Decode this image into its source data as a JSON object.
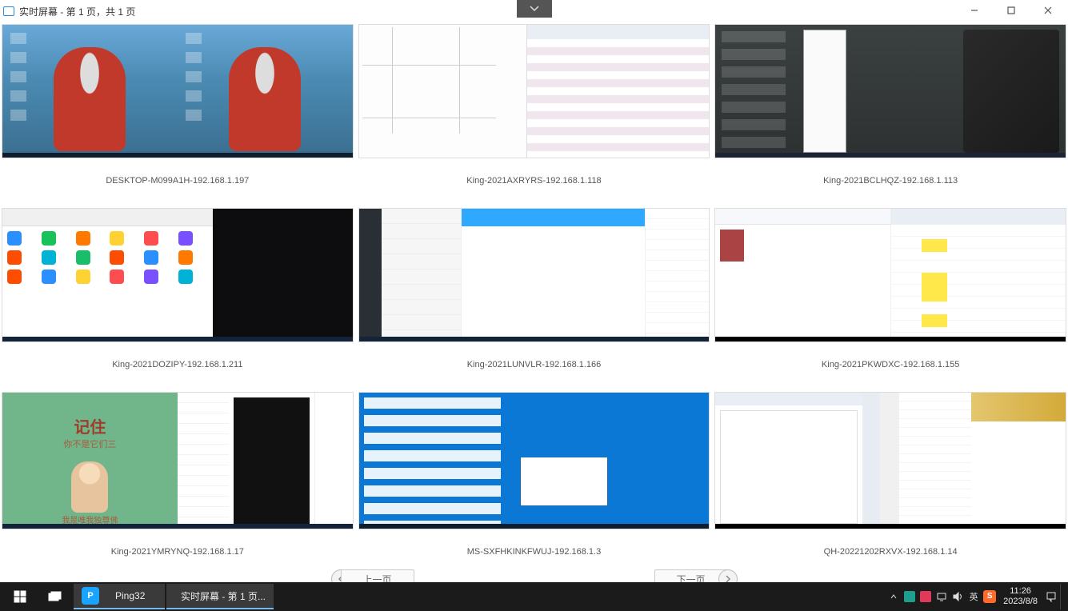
{
  "window": {
    "title": "实时屏幕 - 第 1 页，共 1 页"
  },
  "collapse": {
    "icon": "chevron-down"
  },
  "thumbs": [
    {
      "label": "DESKTOP-M099A1H-192.168.1.197"
    },
    {
      "label": "King-2021AXRYRS-192.168.1.118"
    },
    {
      "label": "King-2021BCLHQZ-192.168.1.113"
    },
    {
      "label": "King-2021DOZIPY-192.168.1.211"
    },
    {
      "label": "King-2021LUNVLR-192.168.1.166"
    },
    {
      "label": "King-2021PKWDXC-192.168.1.155"
    },
    {
      "label": "King-2021YMRYNQ-192.168.1.17"
    },
    {
      "label": "MS-SXFHKINKFWUJ-192.168.1.3"
    },
    {
      "label": "QH-20221202RXVX-192.168.1.14"
    }
  ],
  "cartoon": {
    "title": "记住",
    "subtitle": "你不是它们三",
    "bottom": "我是唯我独尊佛"
  },
  "nav": {
    "prev": "上一页",
    "next": "下一页"
  },
  "taskbar": {
    "apps": {
      "ping32": "Ping32",
      "current": "实时屏幕 - 第 1 页..."
    },
    "ime": "英",
    "clock": {
      "time": "11:26",
      "date": "2023/8/8"
    }
  },
  "icon_colors": {
    "ping32": "#ffffff",
    "ping32_bg": "#1aa3ff",
    "sogou_bg": "#ff6a2b",
    "red_tray": "#e0395a",
    "teal_tray": "#1e9e8e"
  }
}
